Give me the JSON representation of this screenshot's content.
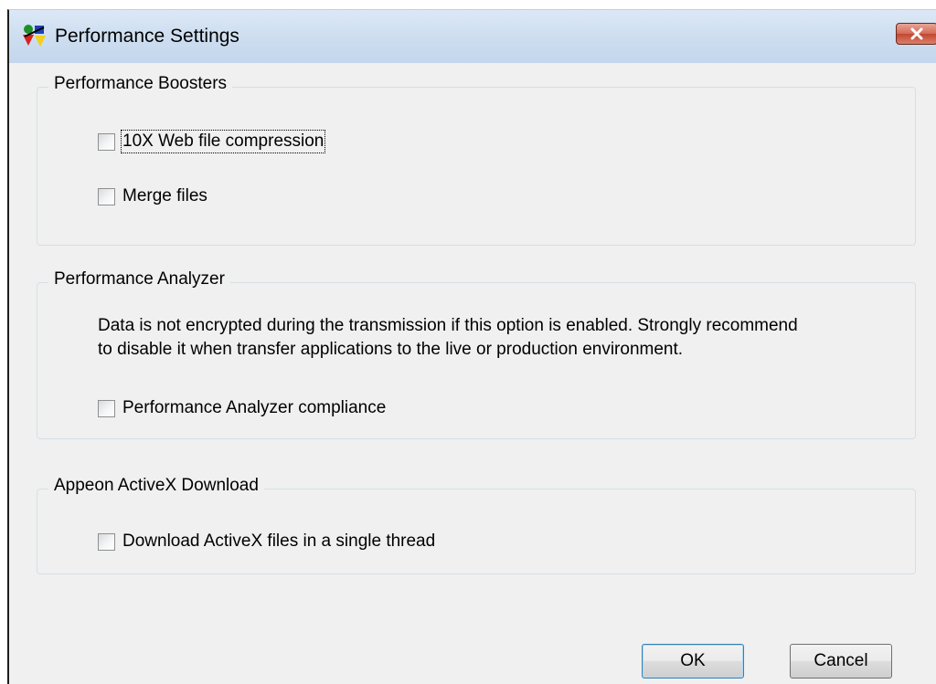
{
  "window": {
    "title": "Performance Settings"
  },
  "groups": {
    "boosters": {
      "title": "Performance Boosters",
      "web_compression": {
        "label": "10X Web file compression",
        "checked": false
      },
      "merge_files": {
        "label": "Merge files",
        "checked": false
      }
    },
    "analyzer": {
      "title": "Performance Analyzer",
      "note_line1": "Data is not encrypted during the transmission if this option is enabled. Strongly recommend",
      "note_line2": "to disable it when transfer applications to the live or production environment.",
      "compliance": {
        "label": "Performance Analyzer compliance",
        "checked": false
      }
    },
    "activex": {
      "title": "Appeon ActiveX Download",
      "single_thread": {
        "label": "Download ActiveX files in a single thread",
        "checked": false
      }
    }
  },
  "buttons": {
    "ok": "OK",
    "cancel": "Cancel"
  },
  "icons": {
    "app": "appeon-app-icon",
    "close": "close-icon"
  },
  "colors": {
    "titlebar": "#cfdff1",
    "dialog_bg": "#f0f0f0",
    "close": "#c44630"
  }
}
